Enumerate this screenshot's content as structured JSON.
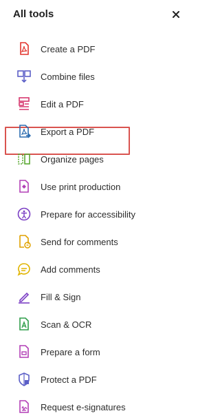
{
  "header": {
    "title": "All tools",
    "close_label": "×"
  },
  "tools": [
    {
      "label": "Create a PDF",
      "icon": "create-pdf-icon",
      "color": "#e2342d"
    },
    {
      "label": "Combine files",
      "icon": "combine-files-icon",
      "color": "#5b5fc7"
    },
    {
      "label": "Edit a PDF",
      "icon": "edit-pdf-icon",
      "color": "#d6366d"
    },
    {
      "label": "Export a PDF",
      "icon": "export-pdf-icon",
      "color": "#2b6cb0"
    },
    {
      "label": "Organize pages",
      "icon": "organize-pages-icon",
      "color": "#5aa832"
    },
    {
      "label": "Use print production",
      "icon": "print-production-icon",
      "color": "#b23fb6"
    },
    {
      "label": "Prepare for accessibility",
      "icon": "accessibility-icon",
      "color": "#7b3fc4"
    },
    {
      "label": "Send for comments",
      "icon": "send-for-comments-icon",
      "color": "#e0a100"
    },
    {
      "label": "Add comments",
      "icon": "add-comments-icon",
      "color": "#e0b400"
    },
    {
      "label": "Fill & Sign",
      "icon": "fill-sign-icon",
      "color": "#7b3fc4"
    },
    {
      "label": "Scan & OCR",
      "icon": "scan-ocr-icon",
      "color": "#2f9d4a"
    },
    {
      "label": "Prepare a form",
      "icon": "prepare-form-icon",
      "color": "#b23fb6"
    },
    {
      "label": "Protect a PDF",
      "icon": "protect-pdf-icon",
      "color": "#5b5fc7"
    },
    {
      "label": "Request e-signatures",
      "icon": "request-esignatures-icon",
      "color": "#b23fb6"
    }
  ],
  "highlight": {
    "item": "Organize pages",
    "color": "#d9534f"
  }
}
